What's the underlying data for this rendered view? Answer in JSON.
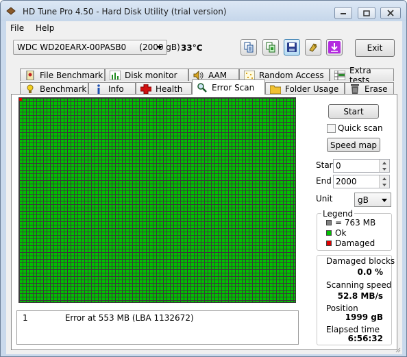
{
  "window": {
    "title": "HD Tune Pro 4.50 - Hard Disk Utility (trial version)"
  },
  "menu": {
    "file": "File",
    "help": "Help"
  },
  "toolbar": {
    "drive": "WDC WD20EARX-00PASB0     (2000 gB)",
    "temperature": "33°C",
    "exit_label": "Exit",
    "icons": [
      "copy-info-icon",
      "copy-screenshot-icon",
      "save-icon",
      "options-icon",
      "download-icon"
    ]
  },
  "tabs": {
    "row1": [
      "File Benchmark",
      "Disk monitor",
      "AAM",
      "Random Access",
      "Extra tests"
    ],
    "row2": [
      "Benchmark",
      "Info",
      "Health",
      "Error Scan",
      "Folder Usage",
      "Erase"
    ],
    "selected": "Error Scan"
  },
  "scan": {
    "start_label": "Start",
    "quick_scan_label": "Quick scan",
    "quick_scan_checked": false,
    "speed_map_label": "Speed map",
    "start_field_label": "Start",
    "start_value": "0",
    "end_field_label": "End",
    "end_value": "2000",
    "unit_label": "Unit",
    "unit_value": "gB"
  },
  "legend": {
    "title": "Legend",
    "block_size": "= 763 MB",
    "ok": "Ok",
    "damaged": "Damaged",
    "colors": {
      "block": "#808080",
      "ok": "#00c000",
      "damaged": "#e00000"
    }
  },
  "stats": {
    "damaged_blocks_label": "Damaged blocks",
    "damaged_blocks_value": "0.0 %",
    "scanning_speed_label": "Scanning speed",
    "scanning_speed_value": "52.8 MB/s",
    "position_label": "Position",
    "position_value": "1999 gB",
    "elapsed_label": "Elapsed time",
    "elapsed_value": "6:56:32"
  },
  "log": [
    {
      "index": "1",
      "message": "Error at 553 MB (LBA 1132672)"
    }
  ]
}
